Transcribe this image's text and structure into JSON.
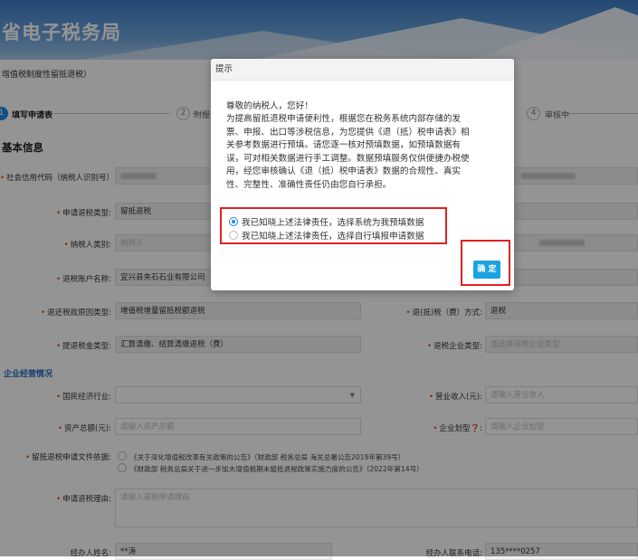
{
  "banner": {
    "title": "省电子税务局"
  },
  "breadcrumb": "增值税制度性留抵退税）",
  "steps": [
    {
      "num": "1",
      "label": "填写申请表",
      "active": true
    },
    {
      "num": "2",
      "label": "附报",
      "active": false
    },
    {
      "num": "4",
      "label": "审核中",
      "active": false
    }
  ],
  "basic_info": {
    "title": "基本信息",
    "credit_code_label": "社会信用代码（纳税人识别号）:",
    "apply_type_label": "申请退税类型:",
    "apply_type_value": "留抵退税",
    "person_type_label": "纳税人类别:",
    "person_type_placeholder": "纳税人",
    "account_label": "退税账户名称:",
    "account_value": "宜兴县夹石石业有限公司",
    "reason_label": "退还税款原因类型:",
    "reason_value": "增值税增量留抵税额退税",
    "refund_method_label": "退(抵)税（费）方式:",
    "refund_method_value": "退税",
    "refund_type_label": "提退税金类型:",
    "refund_type_value": "汇算清缴、结算清缴退税（费）",
    "company_type_label": "退税企业类型:",
    "company_type_placeholder": "请选择退税企业类型"
  },
  "business": {
    "title": "企业经营情况",
    "industry_label": "国民经济行业:",
    "income_label": "营业收入(元):",
    "income_placeholder": "请输入营业收入",
    "assets_label": "资产总额(元):",
    "assets_placeholder": "请输入资产总额",
    "scale_label": "企业划型❓:",
    "scale_placeholder": "请输入企业划型",
    "basis_label": "留抵退税申请文件依据:",
    "basis_options": [
      "《关于深化增值税改革有关政策的公告》（财政部 税务总局 海关总署公告2019年第39号）",
      "《财政部 税务总局关于进一步加大增值税期末留抵退税政策实施力度的公告》（2022年第14号）"
    ],
    "apply_reason_label": "申请退税理由:",
    "apply_reason_placeholder": "请输入退税申请理由",
    "agent_name_label": "经办人姓名:",
    "agent_name_value": "**涛",
    "agent_phone_label": "经办人联系电话:",
    "agent_phone_value": "135****0257"
  },
  "dialog": {
    "title": "提示",
    "greeting": "尊敬的纳税人，您好！",
    "body_lines": [
      "为提高留抵退税申请便利性，根据您在税务系统内部存储的发",
      "票、申报、出口等涉税信息，为您提供《退（抵）税申请表》相",
      "关参考数据进行预填。请您逐一核对预填数据，如预填数据有",
      "误，可对相关数据进行手工调整。数据预填服务仅供便捷办税使",
      "用，经您审核确认《退（抵）税申请表》数据的合规性、真实",
      "性、完整性、准确性责任仍由您自行承担。"
    ],
    "options": [
      {
        "label": "我已知晓上述法律责任，选择系统为我预填数据",
        "selected": true
      },
      {
        "label": "我已知晓上述法律责任，选择自行填报申请数据",
        "selected": false
      }
    ],
    "confirm_label": "确 定"
  },
  "colors": {
    "accent": "#1e8be0",
    "highlight": "#e02222",
    "confirm": "#1aa3e0"
  }
}
